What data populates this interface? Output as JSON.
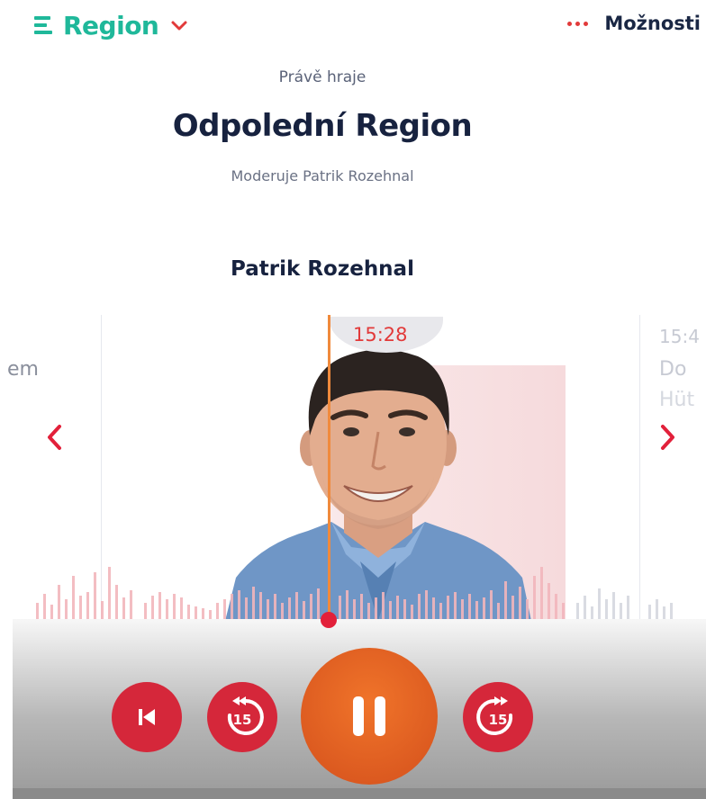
{
  "header": {
    "station_name": "Region",
    "options_label": "Možnosti"
  },
  "show": {
    "now_playing_label": "Právě hraje",
    "title": "Odpolední Region",
    "host_line": "Moderuje Patrik Rozehnal"
  },
  "timeline": {
    "presenter_name": "Patrik Rozehnal",
    "current_time": "15:28",
    "next_time_fragment": "15:4",
    "prev_title_fragment": "em",
    "next_title_fragment_1": "Do",
    "next_title_fragment_2": "Hüt"
  },
  "player": {
    "back_seconds": "15",
    "forward_seconds": "15",
    "state": "playing"
  },
  "colors": {
    "brand": "#1fb89a",
    "accent": "#e23a3a",
    "play_button": "#e8642a",
    "text_dark": "#17223f"
  },
  "icons": {
    "station": "region-logo-icon",
    "dropdown": "chevron-down-icon",
    "options": "more-dots-icon",
    "prev_nav": "chevron-left-icon",
    "next_nav": "chevron-right-icon",
    "previous": "skip-previous-icon",
    "rewind": "rewind-15-icon",
    "pause": "pause-icon",
    "forward": "forward-15-icon"
  }
}
